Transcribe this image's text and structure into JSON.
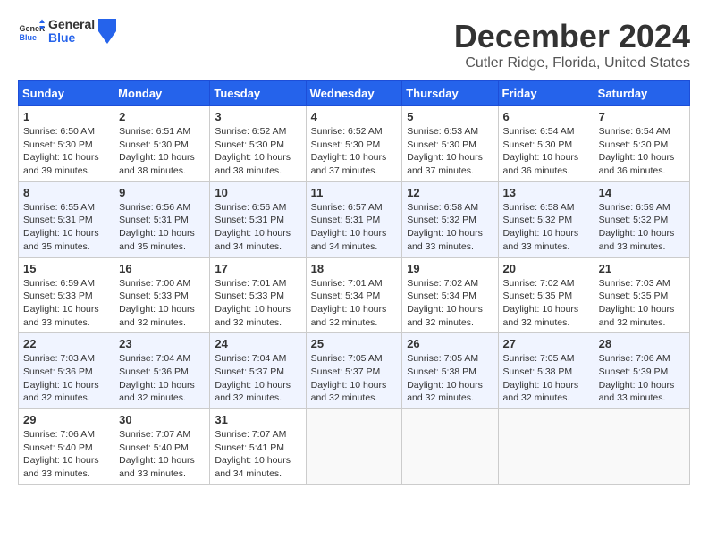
{
  "header": {
    "logo_line1": "General",
    "logo_line2": "Blue",
    "month": "December 2024",
    "location": "Cutler Ridge, Florida, United States"
  },
  "calendar": {
    "weekdays": [
      "Sunday",
      "Monday",
      "Tuesday",
      "Wednesday",
      "Thursday",
      "Friday",
      "Saturday"
    ],
    "weeks": [
      [
        {
          "day": "1",
          "sunrise": "6:50 AM",
          "sunset": "5:30 PM",
          "daylight": "10 hours and 39 minutes."
        },
        {
          "day": "2",
          "sunrise": "6:51 AM",
          "sunset": "5:30 PM",
          "daylight": "10 hours and 38 minutes."
        },
        {
          "day": "3",
          "sunrise": "6:52 AM",
          "sunset": "5:30 PM",
          "daylight": "10 hours and 38 minutes."
        },
        {
          "day": "4",
          "sunrise": "6:52 AM",
          "sunset": "5:30 PM",
          "daylight": "10 hours and 37 minutes."
        },
        {
          "day": "5",
          "sunrise": "6:53 AM",
          "sunset": "5:30 PM",
          "daylight": "10 hours and 37 minutes."
        },
        {
          "day": "6",
          "sunrise": "6:54 AM",
          "sunset": "5:30 PM",
          "daylight": "10 hours and 36 minutes."
        },
        {
          "day": "7",
          "sunrise": "6:54 AM",
          "sunset": "5:30 PM",
          "daylight": "10 hours and 36 minutes."
        }
      ],
      [
        {
          "day": "8",
          "sunrise": "6:55 AM",
          "sunset": "5:31 PM",
          "daylight": "10 hours and 35 minutes."
        },
        {
          "day": "9",
          "sunrise": "6:56 AM",
          "sunset": "5:31 PM",
          "daylight": "10 hours and 35 minutes."
        },
        {
          "day": "10",
          "sunrise": "6:56 AM",
          "sunset": "5:31 PM",
          "daylight": "10 hours and 34 minutes."
        },
        {
          "day": "11",
          "sunrise": "6:57 AM",
          "sunset": "5:31 PM",
          "daylight": "10 hours and 34 minutes."
        },
        {
          "day": "12",
          "sunrise": "6:58 AM",
          "sunset": "5:32 PM",
          "daylight": "10 hours and 33 minutes."
        },
        {
          "day": "13",
          "sunrise": "6:58 AM",
          "sunset": "5:32 PM",
          "daylight": "10 hours and 33 minutes."
        },
        {
          "day": "14",
          "sunrise": "6:59 AM",
          "sunset": "5:32 PM",
          "daylight": "10 hours and 33 minutes."
        }
      ],
      [
        {
          "day": "15",
          "sunrise": "6:59 AM",
          "sunset": "5:33 PM",
          "daylight": "10 hours and 33 minutes."
        },
        {
          "day": "16",
          "sunrise": "7:00 AM",
          "sunset": "5:33 PM",
          "daylight": "10 hours and 32 minutes."
        },
        {
          "day": "17",
          "sunrise": "7:01 AM",
          "sunset": "5:33 PM",
          "daylight": "10 hours and 32 minutes."
        },
        {
          "day": "18",
          "sunrise": "7:01 AM",
          "sunset": "5:34 PM",
          "daylight": "10 hours and 32 minutes."
        },
        {
          "day": "19",
          "sunrise": "7:02 AM",
          "sunset": "5:34 PM",
          "daylight": "10 hours and 32 minutes."
        },
        {
          "day": "20",
          "sunrise": "7:02 AM",
          "sunset": "5:35 PM",
          "daylight": "10 hours and 32 minutes."
        },
        {
          "day": "21",
          "sunrise": "7:03 AM",
          "sunset": "5:35 PM",
          "daylight": "10 hours and 32 minutes."
        }
      ],
      [
        {
          "day": "22",
          "sunrise": "7:03 AM",
          "sunset": "5:36 PM",
          "daylight": "10 hours and 32 minutes."
        },
        {
          "day": "23",
          "sunrise": "7:04 AM",
          "sunset": "5:36 PM",
          "daylight": "10 hours and 32 minutes."
        },
        {
          "day": "24",
          "sunrise": "7:04 AM",
          "sunset": "5:37 PM",
          "daylight": "10 hours and 32 minutes."
        },
        {
          "day": "25",
          "sunrise": "7:05 AM",
          "sunset": "5:37 PM",
          "daylight": "10 hours and 32 minutes."
        },
        {
          "day": "26",
          "sunrise": "7:05 AM",
          "sunset": "5:38 PM",
          "daylight": "10 hours and 32 minutes."
        },
        {
          "day": "27",
          "sunrise": "7:05 AM",
          "sunset": "5:38 PM",
          "daylight": "10 hours and 32 minutes."
        },
        {
          "day": "28",
          "sunrise": "7:06 AM",
          "sunset": "5:39 PM",
          "daylight": "10 hours and 33 minutes."
        }
      ],
      [
        {
          "day": "29",
          "sunrise": "7:06 AM",
          "sunset": "5:40 PM",
          "daylight": "10 hours and 33 minutes."
        },
        {
          "day": "30",
          "sunrise": "7:07 AM",
          "sunset": "5:40 PM",
          "daylight": "10 hours and 33 minutes."
        },
        {
          "day": "31",
          "sunrise": "7:07 AM",
          "sunset": "5:41 PM",
          "daylight": "10 hours and 34 minutes."
        },
        null,
        null,
        null,
        null
      ]
    ]
  }
}
